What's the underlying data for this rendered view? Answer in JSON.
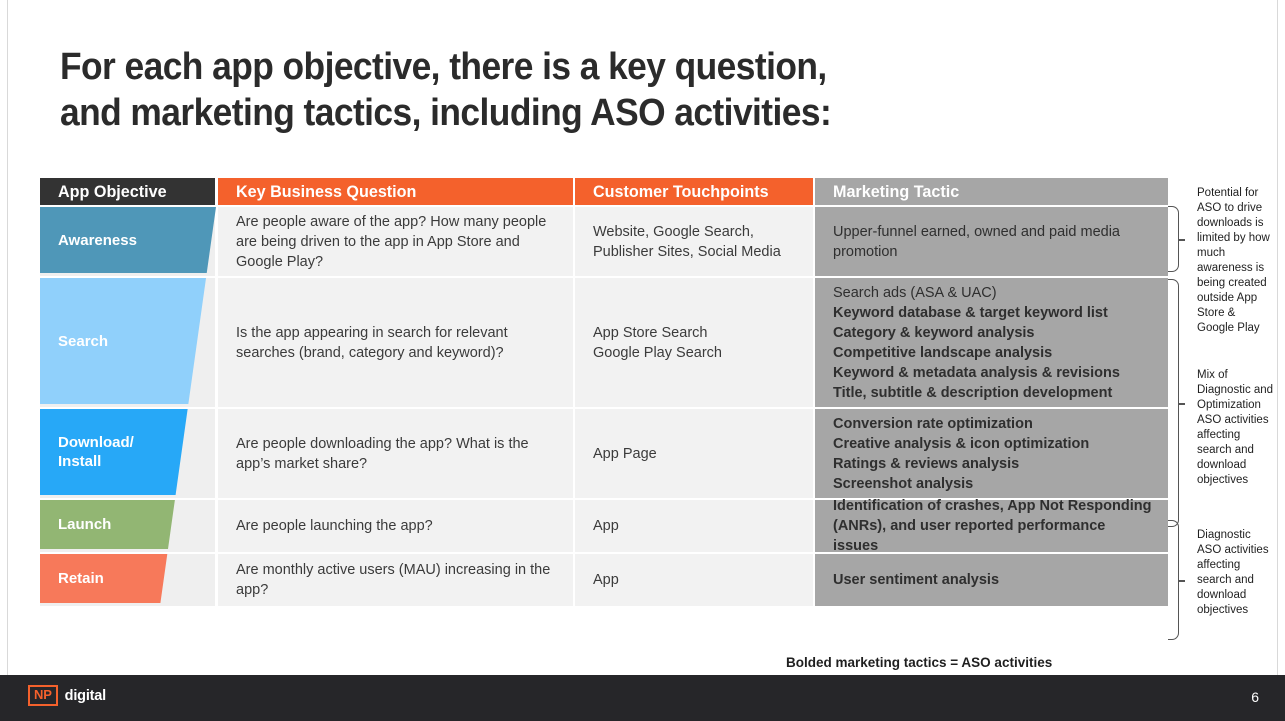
{
  "slide": {
    "title": "For each app objective, there is a key question,\nand marketing tactics, including ASO activities:",
    "page_number": "6",
    "footnote": "Bolded marketing tactics = ASO activities"
  },
  "table": {
    "headers": {
      "objective": "App Objective",
      "question": "Key Business Question",
      "touchpoints": "Customer Touchpoints",
      "tactic": "Marketing Tactic"
    },
    "rows": [
      {
        "objective": "Awareness",
        "color": "#4f97b8",
        "question": "Are people aware of the app? How many people are being driven to the app in App Store and Google Play?",
        "touchpoints": "Website, Google Search,\nPublisher Sites, Social Media",
        "tactics": [
          {
            "text": "Upper-funnel earned, owned and paid media promotion",
            "bold": false
          }
        ]
      },
      {
        "objective": "Search",
        "color": "#90d0fb",
        "question": "Is the app appearing in search for relevant searches (brand, category and keyword)?",
        "touchpoints": "App Store Search\nGoogle Play Search",
        "tactics": [
          {
            "text": "Search ads (ASA & UAC)",
            "bold": false
          },
          {
            "text": "Keyword database & target keyword list",
            "bold": true
          },
          {
            "text": "Category & keyword analysis",
            "bold": true
          },
          {
            "text": "Competitive landscape analysis",
            "bold": true
          },
          {
            "text": "Keyword & metadata analysis & revisions",
            "bold": true
          },
          {
            "text": "Title, subtitle & description development",
            "bold": true
          }
        ]
      },
      {
        "objective": "Download/\nInstall",
        "color": "#27a8f7",
        "question": "Are people downloading the app? What is the app’s market share?",
        "touchpoints": "App Page",
        "tactics": [
          {
            "text": "Conversion rate optimization",
            "bold": true
          },
          {
            "text": "Creative analysis & icon optimization",
            "bold": true
          },
          {
            "text": "Ratings & reviews analysis",
            "bold": true
          },
          {
            "text": "Screenshot analysis",
            "bold": true
          }
        ]
      },
      {
        "objective": "Launch",
        "color": "#92b673",
        "question": "Are people launching the app?",
        "touchpoints": "App",
        "tactics": [
          {
            "text": "Identification of crashes, App Not Responding (ANRs), and user reported performance issues",
            "bold": true
          }
        ]
      },
      {
        "objective": "Retain",
        "color": "#f7795a",
        "question": "Are monthly active users (MAU) increasing in the app?",
        "touchpoints": "App",
        "tactics": [
          {
            "text": "User sentiment analysis",
            "bold": true
          }
        ]
      }
    ]
  },
  "annotations": [
    {
      "text": "Potential for ASO to drive downloads is limited by how much awareness is being created outside App Store & Google Play"
    },
    {
      "text": "Mix of Diagnostic and Optimization ASO activities affecting search and download objectives"
    },
    {
      "text": "Diagnostic ASO activities affecting search and download objectives"
    }
  ],
  "logo": {
    "mark": "NP",
    "word": "digital",
    "accent": "#f4612c"
  }
}
